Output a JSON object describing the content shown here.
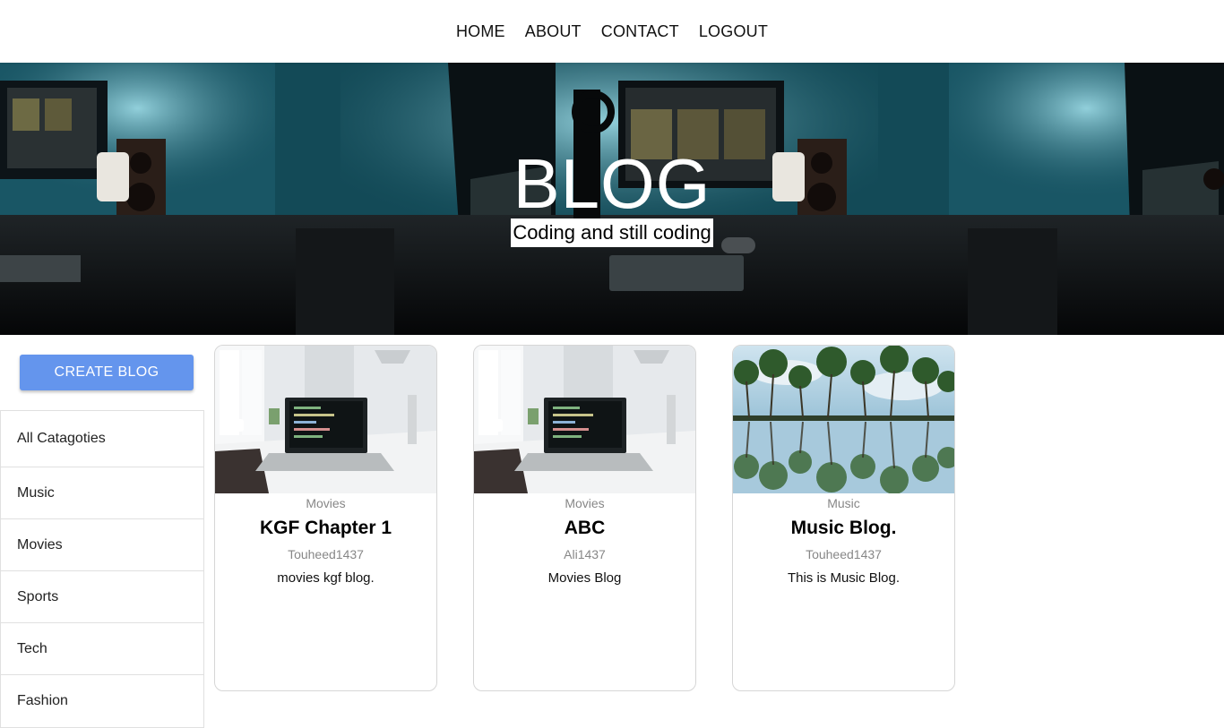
{
  "nav": {
    "items": [
      "HOME",
      "ABOUT",
      "CONTACT",
      "LOGOUT"
    ]
  },
  "banner": {
    "title": "BLOG",
    "subtitle": "Coding and still coding"
  },
  "sidebar": {
    "create_label": "CREATE BLOG",
    "categories": [
      "All Catagoties",
      "Music",
      "Movies",
      "Sports",
      "Tech",
      "Fashion"
    ]
  },
  "posts": [
    {
      "category": "Movies",
      "title": "KGF Chapter 1",
      "author": "Touheed1437",
      "description": "movies kgf blog.",
      "image": "laptop-desk"
    },
    {
      "category": "Movies",
      "title": "ABC",
      "author": "Ali1437",
      "description": "Movies Blog",
      "image": "laptop-desk"
    },
    {
      "category": "Music",
      "title": "Music Blog.",
      "author": "Touheed1437",
      "description": "This is Music Blog.",
      "image": "palm-trees"
    }
  ],
  "colors": {
    "accent": "#6495ed",
    "muted_text": "#878787"
  }
}
